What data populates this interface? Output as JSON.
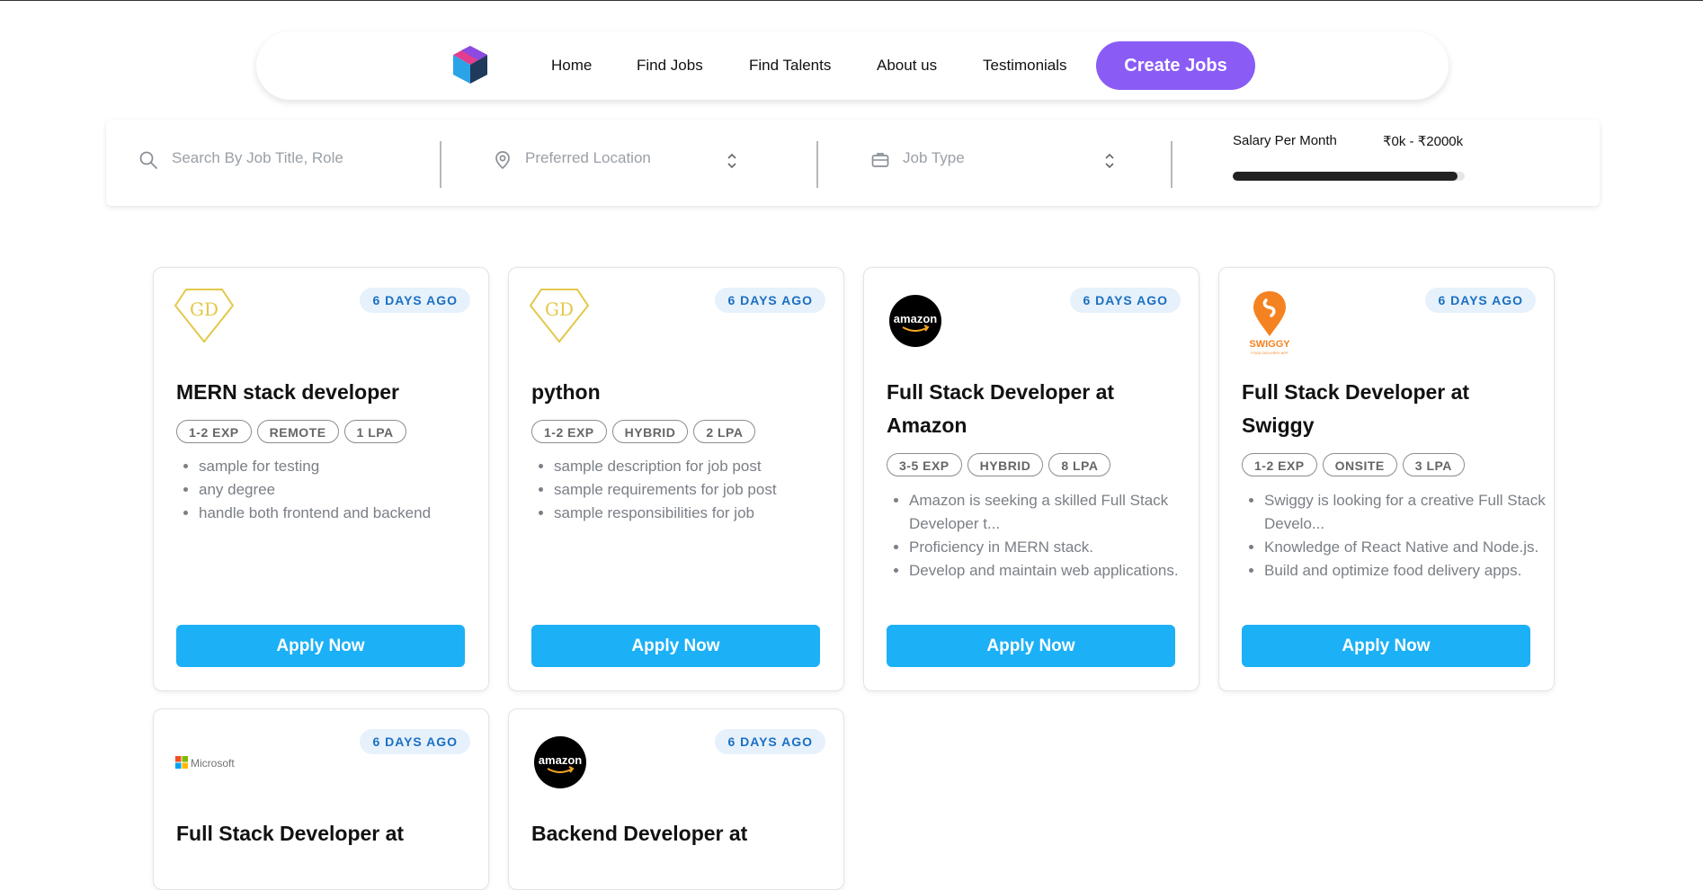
{
  "nav": {
    "links": [
      "Home",
      "Find Jobs",
      "Find Talents",
      "About us",
      "Testimonials"
    ],
    "create_label": "Create Jobs",
    "brand_colors": [
      "#e23d8f",
      "#7d4cf0",
      "#2aa4e6",
      "#1f3a5a"
    ]
  },
  "filters": {
    "search_placeholder": "Search By Job Title, Role",
    "location_placeholder": "Preferred Location",
    "jobtype_placeholder": "Job Type",
    "salary_label": "Salary Per Month",
    "salary_range": "₹0k - ₹2000k",
    "salary_fill_fraction": 0.97
  },
  "cards": [
    {
      "posted": "6 DAYS AGO",
      "logo": "GD",
      "title": "MERN stack developer",
      "tags": [
        "1-2 EXP",
        "REMOTE",
        "1 LPA"
      ],
      "points": [
        "sample for testing",
        "any degree",
        "handle both frontend and backend"
      ],
      "apply": "Apply Now"
    },
    {
      "posted": "6 DAYS AGO",
      "logo": "GD",
      "title": "python",
      "tags": [
        "1-2 EXP",
        "HYBRID",
        "2 LPA"
      ],
      "points": [
        "sample description for job post",
        "sample requirements for job post",
        "sample responsibilities for job"
      ],
      "apply": "Apply Now"
    },
    {
      "posted": "6 DAYS AGO",
      "logo": "amazon",
      "title": "Full Stack Developer at Amazon",
      "tags": [
        "3-5 EXP",
        "HYBRID",
        "8 LPA"
      ],
      "points": [
        "Amazon is seeking a skilled Full Stack Developer t...",
        "Proficiency in MERN stack.",
        "Develop and maintain web applications."
      ],
      "apply": "Apply Now"
    },
    {
      "posted": "6 DAYS AGO",
      "logo": "SWIGGY",
      "logo_sub": "FOOD DELIVERY APP",
      "title": "Full Stack Developer at Swiggy",
      "tags": [
        "1-2 EXP",
        "ONSITE",
        "3 LPA"
      ],
      "points": [
        "Swiggy is looking for a creative Full Stack Develo...",
        "Knowledge of React Native and Node.js.",
        "Build and optimize food delivery apps."
      ],
      "apply": "Apply Now"
    },
    {
      "posted": "6 DAYS AGO",
      "logo": "Microsoft",
      "title": "Full Stack Developer at"
    },
    {
      "posted": "6 DAYS AGO",
      "logo": "amazon",
      "title": "Backend Developer at"
    }
  ],
  "colors": {
    "accent_purple": "#8a5cf5",
    "apply_blue": "#1cb0f6",
    "badge_bg": "#e6f1fb",
    "badge_text": "#1a6fc2",
    "gd_gold": "#e3c84a",
    "swiggy_orange": "#f58220"
  }
}
